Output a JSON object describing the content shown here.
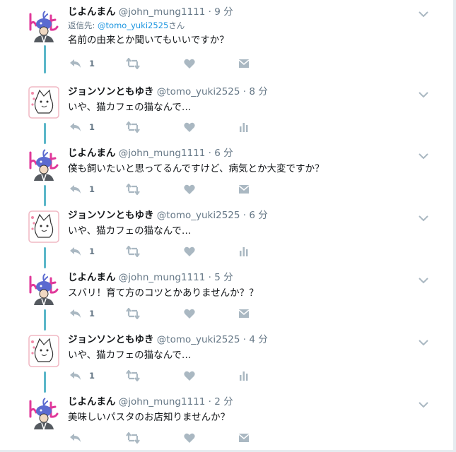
{
  "colors": {
    "text": "#14171a",
    "secondary": "#657786",
    "link": "#1b95e0",
    "icon": "#aab8c2",
    "thread_line": "#5bb7c9"
  },
  "reply_context": {
    "prefix": "返信先: ",
    "mention": "@tomo_yuki2525",
    "suffix": "さん"
  },
  "tweets": [
    {
      "name": "じよんまん",
      "handle": "@john_mung1111",
      "sep": "·",
      "time": "9 分",
      "text": "名前の由来とか聞いてもいいですか？",
      "reply_count": "1",
      "avatar_icon": "whale-person-avatar-icon",
      "last_action": "dm-icon"
    },
    {
      "name": "ジョンソンともゆき",
      "handle": "@tomo_yuki2525",
      "sep": "·",
      "time": "8 分",
      "text": "いや、猫カフェの猫なんで…",
      "reply_count": "1",
      "avatar_icon": "cartoon-cat-avatar-icon",
      "last_action": "analytics-icon"
    },
    {
      "name": "じよんまん",
      "handle": "@john_mung1111",
      "sep": "·",
      "time": "6 分",
      "text": "僕も飼いたいと思ってるんですけど、病気とか大変ですか？",
      "reply_count": "1",
      "avatar_icon": "whale-person-avatar-icon",
      "last_action": "dm-icon"
    },
    {
      "name": "ジョンソンともゆき",
      "handle": "@tomo_yuki2525",
      "sep": "·",
      "time": "6 分",
      "text": "いや、猫カフェの猫なんで…",
      "reply_count": "1",
      "avatar_icon": "cartoon-cat-avatar-icon",
      "last_action": "analytics-icon"
    },
    {
      "name": "じよんまん",
      "handle": "@john_mung1111",
      "sep": "·",
      "time": "5 分",
      "text": "スバリ！育て方のコツとかありませんか？？",
      "reply_count": "1",
      "avatar_icon": "whale-person-avatar-icon",
      "last_action": "dm-icon"
    },
    {
      "name": "ジョンソンともゆき",
      "handle": "@tomo_yuki2525",
      "sep": "·",
      "time": "4 分",
      "text": "いや、猫カフェの猫なんで…",
      "reply_count": "1",
      "avatar_icon": "cartoon-cat-avatar-icon",
      "last_action": "analytics-icon"
    },
    {
      "name": "じよんまん",
      "handle": "@john_mung1111",
      "sep": "·",
      "time": "2 分",
      "text": "美味しいパスタのお店知りませんか？",
      "reply_count": "",
      "avatar_icon": "whale-person-avatar-icon",
      "last_action": "dm-icon"
    }
  ]
}
